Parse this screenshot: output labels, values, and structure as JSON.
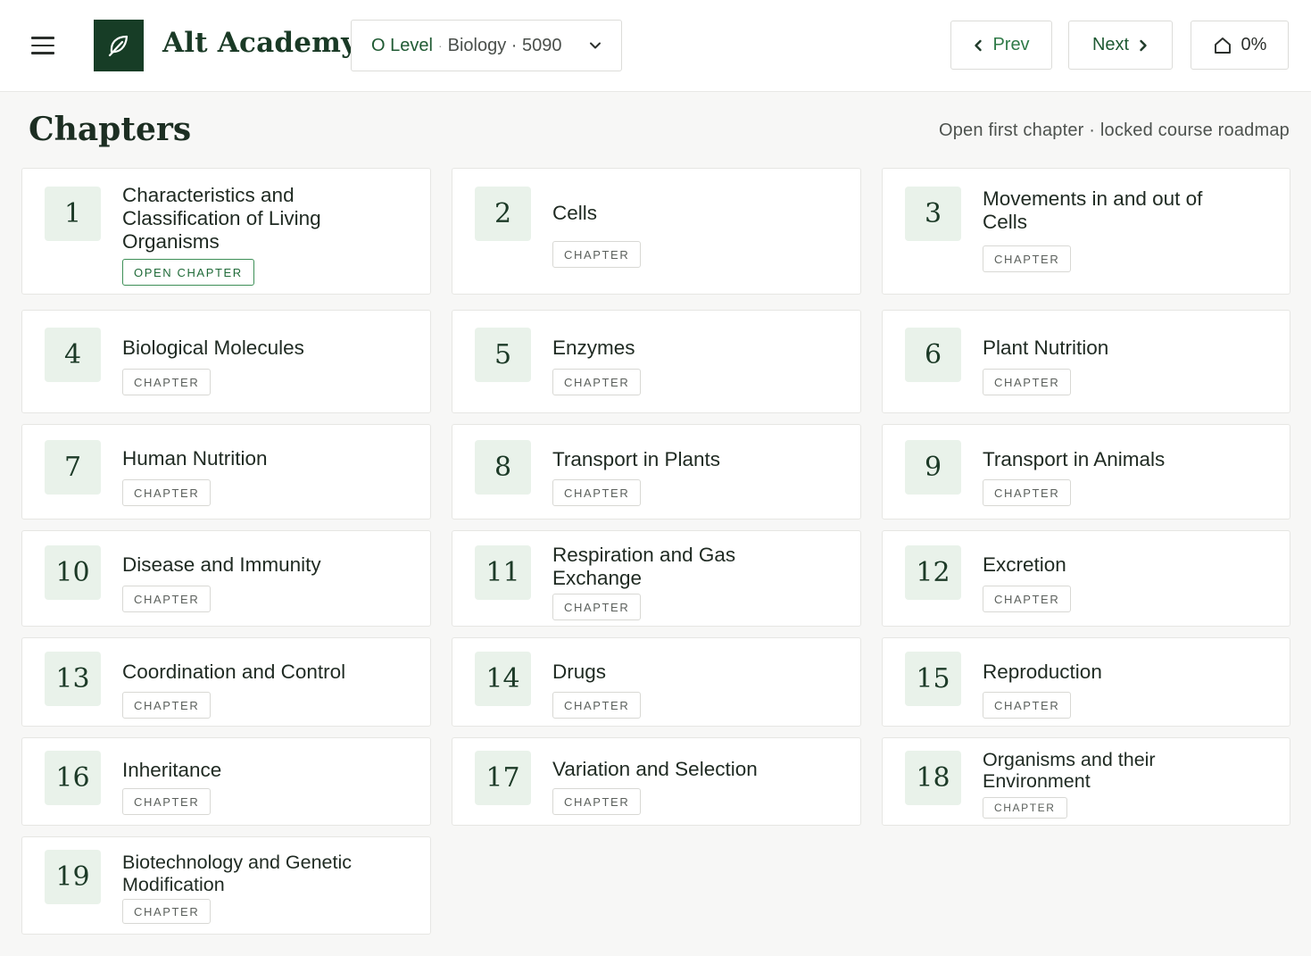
{
  "header": {
    "brand": "Alt Academy",
    "course": {
      "level": "O Level",
      "separator": "·",
      "subject": "Biology · 5090"
    },
    "prev_label": "Prev",
    "next_label": "Next",
    "progress": "0%"
  },
  "page": {
    "title": "Chapters",
    "subtitle": "Open first chapter · locked course roadmap"
  },
  "colors": {
    "brand": "#173d26",
    "accent": "#2f7a47",
    "number_bg": "#e9f2ea"
  },
  "icons": {
    "menu": "hamburger-icon",
    "logo": "leaf-icon",
    "course_dropdown": "chevron-down-icon",
    "prev": "chevron-left-icon",
    "next": "chevron-right-icon",
    "home": "home-icon"
  },
  "chapters": [
    {
      "number": "1",
      "title": "Characteristics and Classification of Living Organisms",
      "badge": "OPEN CHAPTER"
    },
    {
      "number": "2",
      "title": "Cells",
      "badge": "CHAPTER"
    },
    {
      "number": "3",
      "title": "Movements in and out of Cells",
      "badge": "CHAPTER"
    },
    {
      "number": "4",
      "title": "Biological Molecules",
      "badge": "CHAPTER"
    },
    {
      "number": "5",
      "title": "Enzymes",
      "badge": "CHAPTER"
    },
    {
      "number": "6",
      "title": "Plant Nutrition",
      "badge": "CHAPTER"
    },
    {
      "number": "7",
      "title": "Human Nutrition",
      "badge": "CHAPTER"
    },
    {
      "number": "8",
      "title": "Transport in Plants",
      "badge": "CHAPTER"
    },
    {
      "number": "9",
      "title": "Transport in Animals",
      "badge": "CHAPTER"
    },
    {
      "number": "10",
      "title": "Disease and Immunity",
      "badge": "CHAPTER"
    },
    {
      "number": "11",
      "title": "Respiration and Gas Exchange",
      "badge": "CHAPTER"
    },
    {
      "number": "12",
      "title": "Excretion",
      "badge": "CHAPTER"
    },
    {
      "number": "13",
      "title": "Coordination and Control",
      "badge": "CHAPTER"
    },
    {
      "number": "14",
      "title": "Drugs",
      "badge": "CHAPTER"
    },
    {
      "number": "15",
      "title": "Reproduction",
      "badge": "CHAPTER"
    },
    {
      "number": "16",
      "title": "Inheritance",
      "badge": "CHAPTER"
    },
    {
      "number": "17",
      "title": "Variation and Selection",
      "badge": "CHAPTER"
    },
    {
      "number": "18",
      "title": "Organisms and their Environment",
      "badge": "CHAPTER"
    },
    {
      "number": "19",
      "title": "Biotechnology and Genetic Modification",
      "badge": "CHAPTER"
    }
  ]
}
